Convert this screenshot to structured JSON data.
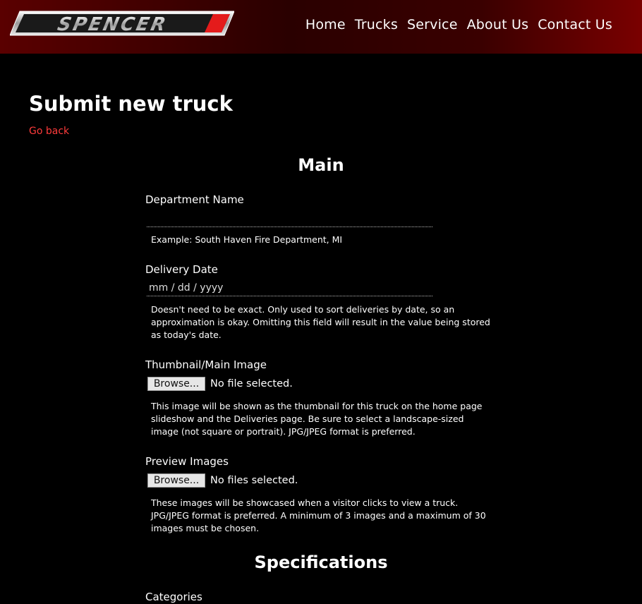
{
  "brand": {
    "logo_text": "SPENCER"
  },
  "nav": {
    "items": [
      "Home",
      "Trucks",
      "Service",
      "About Us",
      "Contact Us"
    ]
  },
  "page": {
    "title": "Submit new truck",
    "back_link": "Go back"
  },
  "sections": {
    "main": "Main",
    "specifications": "Specifications"
  },
  "fields": {
    "department": {
      "label": "Department Name",
      "value": "",
      "help": "Example: South Haven Fire Department, MI"
    },
    "delivery_date": {
      "label": "Delivery Date",
      "placeholder": "mm / dd / yyyy",
      "help": "Doesn't need to be exact. Only used to sort deliveries by date, so an approximation is okay. Omitting this field will result in the value being stored as today's date."
    },
    "thumbnail": {
      "label": "Thumbnail/Main Image",
      "button": "Browse...",
      "status": "No file selected.",
      "help": "This image will be shown as the thumbnail for this truck on the home page slideshow and the Deliveries page. Be sure to select a landscape-sized image (not square or portrait). JPG/JPEG format is preferred."
    },
    "preview_images": {
      "label": "Preview Images",
      "button": "Browse...",
      "status": "No files selected.",
      "help": "These images will be showcased when a visitor clicks to view a truck. JPG/JPEG format is preferred. A minimum of 3 images and a maximum of 30 images must be chosen."
    },
    "categories": {
      "label": "Categories"
    }
  },
  "colors": {
    "header_red": "#5a0000",
    "link_red": "#ff3b3b",
    "logo_red": "#e41b1b"
  }
}
